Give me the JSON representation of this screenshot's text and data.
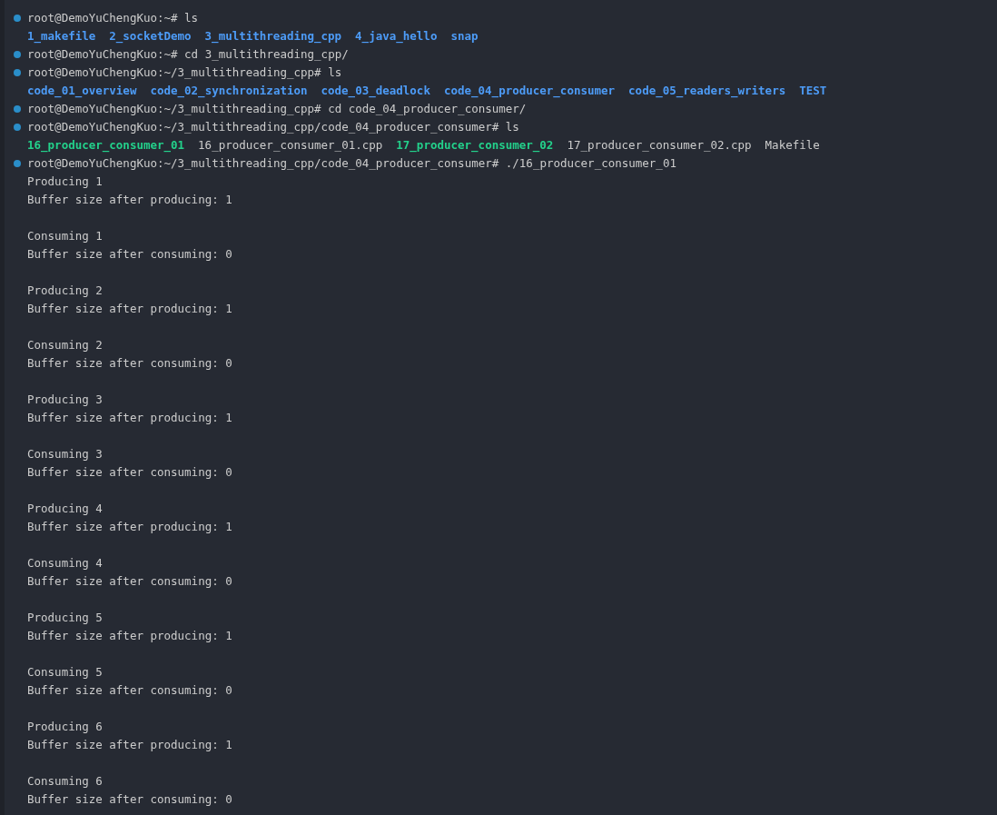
{
  "terminal": {
    "lines": [
      {
        "kind": "prompt",
        "text": "root@DemoYuChengKuo:~# ls"
      },
      {
        "kind": "listing",
        "entries": [
          {
            "kind": "dir",
            "text": "1_makefile"
          },
          {
            "kind": "dir",
            "text": "2_socketDemo"
          },
          {
            "kind": "dir",
            "text": "3_multithreading_cpp"
          },
          {
            "kind": "dir",
            "text": "4_java_hello"
          },
          {
            "kind": "dir",
            "text": "snap"
          }
        ]
      },
      {
        "kind": "prompt",
        "text": "root@DemoYuChengKuo:~# cd 3_multithreading_cpp/"
      },
      {
        "kind": "prompt",
        "text": "root@DemoYuChengKuo:~/3_multithreading_cpp# ls"
      },
      {
        "kind": "listing",
        "entries": [
          {
            "kind": "dir",
            "text": "code_01_overview"
          },
          {
            "kind": "dir",
            "text": "code_02_synchronization"
          },
          {
            "kind": "dir",
            "text": "code_03_deadlock"
          },
          {
            "kind": "dir",
            "text": "code_04_producer_consumer"
          },
          {
            "kind": "dir",
            "text": "code_05_readers_writers"
          },
          {
            "kind": "dir",
            "text": "TEST"
          }
        ]
      },
      {
        "kind": "prompt",
        "text": "root@DemoYuChengKuo:~/3_multithreading_cpp# cd code_04_producer_consumer/"
      },
      {
        "kind": "prompt",
        "text": "root@DemoYuChengKuo:~/3_multithreading_cpp/code_04_producer_consumer# ls"
      },
      {
        "kind": "listing",
        "entries": [
          {
            "kind": "exec",
            "text": "16_producer_consumer_01"
          },
          {
            "kind": "file",
            "text": "16_producer_consumer_01.cpp"
          },
          {
            "kind": "exec",
            "text": "17_producer_consumer_02"
          },
          {
            "kind": "file",
            "text": "17_producer_consumer_02.cpp"
          },
          {
            "kind": "file",
            "text": "Makefile"
          }
        ]
      },
      {
        "kind": "prompt",
        "text": "root@DemoYuChengKuo:~/3_multithreading_cpp/code_04_producer_consumer# ./16_producer_consumer_01"
      },
      {
        "kind": "output",
        "text": "Producing 1"
      },
      {
        "kind": "output",
        "text": "Buffer size after producing: 1"
      },
      {
        "kind": "blank"
      },
      {
        "kind": "output",
        "text": "Consuming 1"
      },
      {
        "kind": "output",
        "text": "Buffer size after consuming: 0"
      },
      {
        "kind": "blank"
      },
      {
        "kind": "output",
        "text": "Producing 2"
      },
      {
        "kind": "output",
        "text": "Buffer size after producing: 1"
      },
      {
        "kind": "blank"
      },
      {
        "kind": "output",
        "text": "Consuming 2"
      },
      {
        "kind": "output",
        "text": "Buffer size after consuming: 0"
      },
      {
        "kind": "blank"
      },
      {
        "kind": "output",
        "text": "Producing 3"
      },
      {
        "kind": "output",
        "text": "Buffer size after producing: 1"
      },
      {
        "kind": "blank"
      },
      {
        "kind": "output",
        "text": "Consuming 3"
      },
      {
        "kind": "output",
        "text": "Buffer size after consuming: 0"
      },
      {
        "kind": "blank"
      },
      {
        "kind": "output",
        "text": "Producing 4"
      },
      {
        "kind": "output",
        "text": "Buffer size after producing: 1"
      },
      {
        "kind": "blank"
      },
      {
        "kind": "output",
        "text": "Consuming 4"
      },
      {
        "kind": "output",
        "text": "Buffer size after consuming: 0"
      },
      {
        "kind": "blank"
      },
      {
        "kind": "output",
        "text": "Producing 5"
      },
      {
        "kind": "output",
        "text": "Buffer size after producing: 1"
      },
      {
        "kind": "blank"
      },
      {
        "kind": "output",
        "text": "Consuming 5"
      },
      {
        "kind": "output",
        "text": "Buffer size after consuming: 0"
      },
      {
        "kind": "blank"
      },
      {
        "kind": "output",
        "text": "Producing 6"
      },
      {
        "kind": "output",
        "text": "Buffer size after producing: 1"
      },
      {
        "kind": "blank"
      },
      {
        "kind": "output",
        "text": "Consuming 6"
      },
      {
        "kind": "output",
        "text": "Buffer size after consuming: 0"
      }
    ]
  }
}
